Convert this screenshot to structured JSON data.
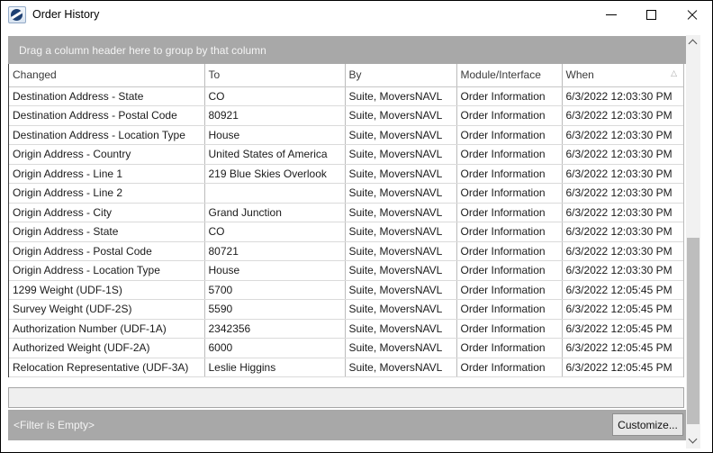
{
  "window": {
    "title": "Order History"
  },
  "icons": {
    "app_logo": "moverssuite-logo",
    "minimize": "minimize-icon",
    "maximize": "maximize-icon",
    "close": "close-icon",
    "sort_asc": "△",
    "scroll_up": "chevron-up",
    "scroll_down": "chevron-down"
  },
  "group_panel": {
    "text": "Drag a column header here to group by that column"
  },
  "grid": {
    "columns": [
      {
        "key": "changed",
        "label": "Changed"
      },
      {
        "key": "to",
        "label": "To"
      },
      {
        "key": "by",
        "label": "By"
      },
      {
        "key": "module",
        "label": "Module/Interface"
      },
      {
        "key": "when",
        "label": "When",
        "sorted": "asc"
      }
    ],
    "rows": [
      {
        "changed": "Destination Address - State",
        "to": "CO",
        "by": "Suite, MoversNAVL",
        "module": "Order Information",
        "when": "6/3/2022 12:03:30 PM"
      },
      {
        "changed": "Destination Address - Postal Code",
        "to": "80921",
        "by": "Suite, MoversNAVL",
        "module": "Order Information",
        "when": "6/3/2022 12:03:30 PM"
      },
      {
        "changed": "Destination Address - Location Type",
        "to": "House",
        "by": "Suite, MoversNAVL",
        "module": "Order Information",
        "when": "6/3/2022 12:03:30 PM"
      },
      {
        "changed": "Origin Address - Country",
        "to": "United States of America",
        "by": "Suite, MoversNAVL",
        "module": "Order Information",
        "when": "6/3/2022 12:03:30 PM"
      },
      {
        "changed": "Origin Address - Line 1",
        "to": "219 Blue Skies Overlook",
        "by": "Suite, MoversNAVL",
        "module": "Order Information",
        "when": "6/3/2022 12:03:30 PM"
      },
      {
        "changed": "Origin Address - Line 2",
        "to": "",
        "by": "Suite, MoversNAVL",
        "module": "Order Information",
        "when": "6/3/2022 12:03:30 PM"
      },
      {
        "changed": "Origin Address - City",
        "to": "Grand Junction",
        "by": "Suite, MoversNAVL",
        "module": "Order Information",
        "when": "6/3/2022 12:03:30 PM"
      },
      {
        "changed": "Origin Address - State",
        "to": "CO",
        "by": "Suite, MoversNAVL",
        "module": "Order Information",
        "when": "6/3/2022 12:03:30 PM"
      },
      {
        "changed": "Origin Address - Postal Code",
        "to": "80721",
        "by": "Suite, MoversNAVL",
        "module": "Order Information",
        "when": "6/3/2022 12:03:30 PM"
      },
      {
        "changed": "Origin Address - Location Type",
        "to": "House",
        "by": "Suite, MoversNAVL",
        "module": "Order Information",
        "when": "6/3/2022 12:03:30 PM"
      },
      {
        "changed": "1299 Weight (UDF-1S)",
        "to": "5700",
        "by": "Suite, MoversNAVL",
        "module": "Order Information",
        "when": "6/3/2022 12:05:45 PM"
      },
      {
        "changed": "Survey Weight (UDF-2S)",
        "to": "5590",
        "by": "Suite, MoversNAVL",
        "module": "Order Information",
        "when": "6/3/2022 12:05:45 PM"
      },
      {
        "changed": "Authorization Number (UDF-1A)",
        "to": "2342356",
        "by": "Suite, MoversNAVL",
        "module": "Order Information",
        "when": "6/3/2022 12:05:45 PM"
      },
      {
        "changed": "Authorized Weight (UDF-2A)",
        "to": "6000",
        "by": "Suite, MoversNAVL",
        "module": "Order Information",
        "when": "6/3/2022 12:05:45 PM"
      },
      {
        "changed": "Relocation Representative (UDF-3A)",
        "to": "Leslie Higgins",
        "by": "Suite, MoversNAVL",
        "module": "Order Information",
        "when": "6/3/2022 12:05:45 PM"
      }
    ]
  },
  "filter_bar": {
    "status": "<Filter is Empty>",
    "customize_label": "Customize..."
  },
  "colors": {
    "panel_gray": "#a8a8a8",
    "logo_blue": "#1d3f72",
    "scroll_track": "#f1f1f1",
    "scroll_thumb": "#bdbdbd"
  }
}
